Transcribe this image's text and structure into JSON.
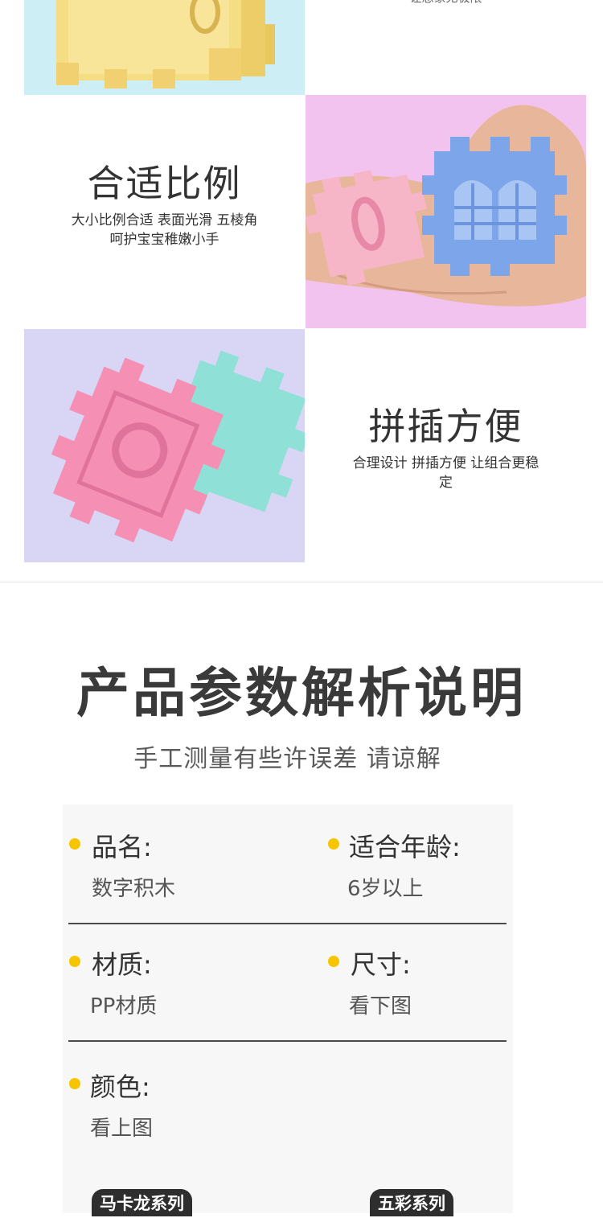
{
  "features": {
    "cut_caption": "让想象无极限",
    "proportion": {
      "title": "合适比例",
      "desc_line1": "大小比例合适 表面光滑 五棱角",
      "desc_line2": "呵护宝宝稚嫩小手"
    },
    "assembly": {
      "title": "拼插方便",
      "desc_line1": "合理设计 拼插方便 让组合更稳",
      "desc_line2": "定"
    }
  },
  "params": {
    "title": "产品参数解析说明",
    "subtitle": "手工测量有些许误差 请谅解",
    "items": [
      {
        "label": "品名:",
        "value": "数字积木"
      },
      {
        "label": "适合年龄:",
        "value": "6岁以上"
      },
      {
        "label": "材质:",
        "value": "PP材质"
      },
      {
        "label": "尺寸:",
        "value": "看下图"
      },
      {
        "label": "颜色:",
        "value": "看上图"
      }
    ],
    "series": [
      "马卡龙系列",
      "五彩系列"
    ]
  },
  "colors": {
    "bullet": "#f6c500",
    "tile_blue_bg": "#cdeef4",
    "tile_pink_bg": "#f3c3ef",
    "tile_lavender_bg": "#d9d6f5"
  }
}
